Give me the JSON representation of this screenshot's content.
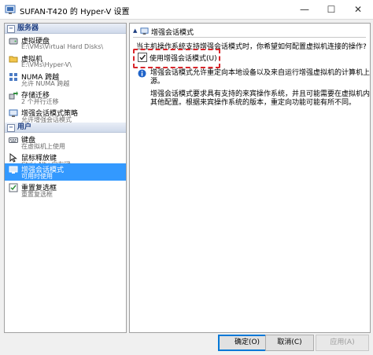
{
  "window": {
    "title": "SUFAN-T420 的 Hyper-V 设置",
    "controls": {
      "minimize": "—",
      "maximize": "☐",
      "close": "✕"
    }
  },
  "sidebar": {
    "sections": [
      {
        "label": "服务器",
        "toggle": "−"
      },
      {
        "label": "用户",
        "toggle": "−"
      }
    ],
    "server_items": [
      {
        "label": "虚拟硬盘",
        "sub": "E:\\VMs\\Virtual Hard Disks\\",
        "icon": "hard-disk-icon"
      },
      {
        "label": "虚拟机",
        "sub": "E:\\VMs\\Hyper-V\\",
        "icon": "folder-icon"
      },
      {
        "label": "NUMA 跨越",
        "sub": "允许 NUMA 跨越",
        "icon": "numa-icon"
      },
      {
        "label": "存储迁移",
        "sub": "2 个并行迁移",
        "icon": "migration-icon"
      },
      {
        "label": "增强会话模式策略",
        "sub": "允许增强会话模式",
        "icon": "session-policy-icon"
      }
    ],
    "user_items": [
      {
        "label": "键盘",
        "sub": "在虚拟机上使用",
        "icon": "keyboard-icon"
      },
      {
        "label": "鼠标释放键",
        "sub": "Ctrl+Alt+向左键",
        "icon": "mouse-icon"
      },
      {
        "label": "增强会话模式",
        "sub": "可用时使用",
        "icon": "session-icon",
        "selected": true
      },
      {
        "label": "重置复选框",
        "sub": "重置复选框",
        "icon": "reset-icon"
      }
    ]
  },
  "main": {
    "header": "增强会话模式",
    "question": "当主机操作系统支持增强会话模式时，你希望如何配置虚拟机连接的操作?",
    "checkbox_label": "使用增强会话模式(U)",
    "checkbox_checked": true,
    "info_para1": [
      "增强会话模式允许重定向本地设备以及来自运行增强虚拟机的计算机上的资",
      "源。"
    ],
    "info_para2": [
      "增强会话模式要求具有支持的来宾操作系统，并且可能需要在虚拟机内进行",
      "其他配置。根据来宾操作系统的版本，重定向功能可能有所不同。"
    ]
  },
  "footer": {
    "ok": "确定(O)",
    "cancel": "取消(C)",
    "apply": "应用(A)"
  },
  "colors": {
    "selection": "#3399ff",
    "section_text": "#1f3f82",
    "highlight_border": "#d9262b",
    "default_button_border": "#0078d7"
  }
}
